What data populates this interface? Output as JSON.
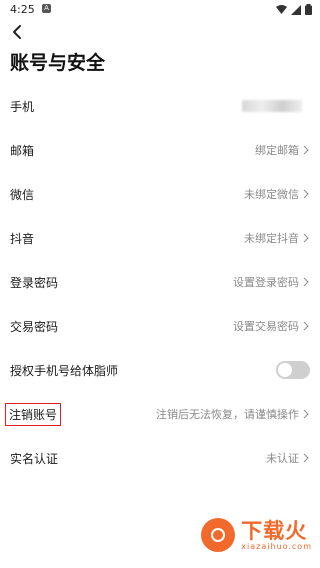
{
  "status": {
    "time": "4:25",
    "notif": "A"
  },
  "page": {
    "title": "账号与安全"
  },
  "rows": [
    {
      "label": "手机",
      "value": ""
    },
    {
      "label": "邮箱",
      "value": "绑定邮箱"
    },
    {
      "label": "微信",
      "value": "未绑定微信"
    },
    {
      "label": "抖音",
      "value": "未绑定抖音"
    },
    {
      "label": "登录密码",
      "value": "设置登录密码"
    },
    {
      "label": "交易密码",
      "value": "设置交易密码"
    },
    {
      "label": "授权手机号给体脂师",
      "toggle": false
    },
    {
      "label": "注销账号",
      "value": "注销后无法恢复，请谨慎操作"
    },
    {
      "label": "实名认证",
      "value": "未认证"
    }
  ],
  "watermark": {
    "main": "下载火",
    "sub": "xiazaihuo.com"
  },
  "colors": {
    "accent": "#f26a2b",
    "highlight": "#e02020",
    "secondary_text": "#8a8a8a"
  }
}
